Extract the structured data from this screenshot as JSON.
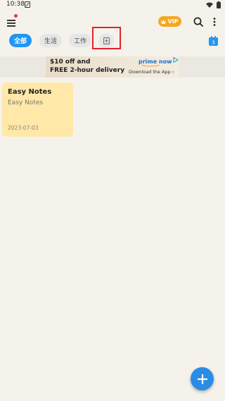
{
  "status": {
    "time": "10:38"
  },
  "tabs": [
    {
      "label": "全部"
    },
    {
      "label": "生活"
    },
    {
      "label": "工作"
    }
  ],
  "vip": {
    "label": "VIP"
  },
  "ad": {
    "line1": "$10 off and",
    "line2": "FREE 2-hour delivery",
    "brand": "prime now",
    "cta": "Download the App ›"
  },
  "notes": [
    {
      "title": "Easy Notes",
      "body": "Easy Notes",
      "date": "2023-07-03"
    }
  ],
  "calendar": {
    "day": "3"
  },
  "colors": {
    "accent": "#2196f3",
    "vip": "#f5a623",
    "note": "#ffe8a8",
    "highlight": "#e5202a"
  }
}
